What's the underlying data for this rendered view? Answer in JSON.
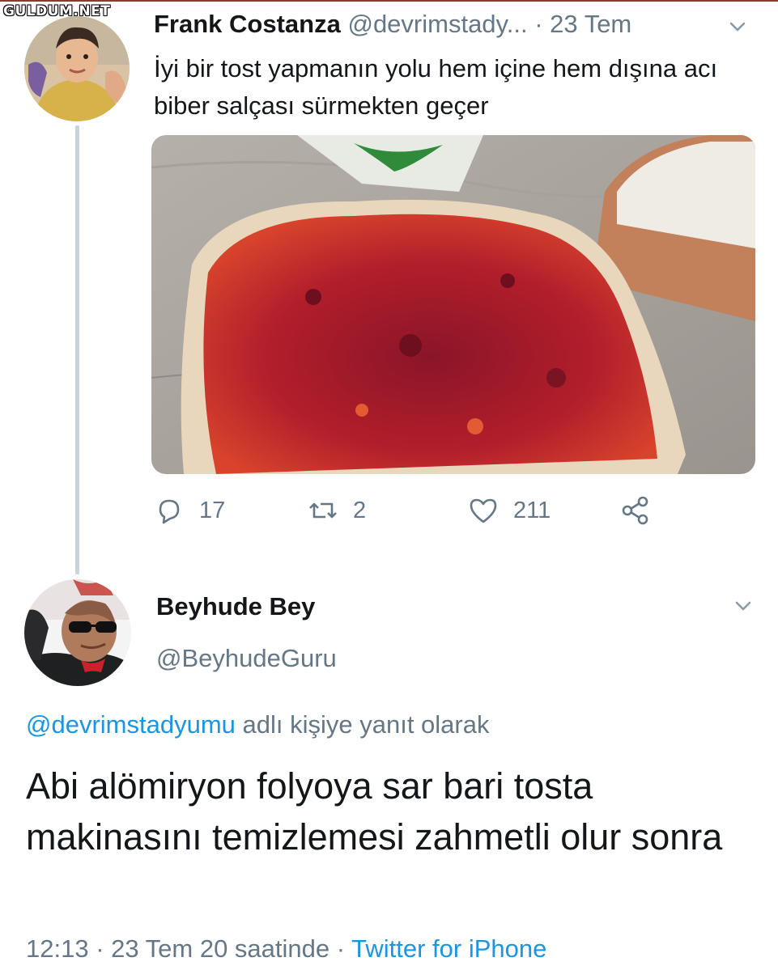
{
  "watermark": "GULDUM.NET",
  "tweet1": {
    "name": "Frank Costanza",
    "handle": "@devrimstady...",
    "time": "· 23 Tem",
    "text": "İyi bir tost yapmanın yolu hem içine hem dışına acı biber salçası sürmekten geçer",
    "avatar": "avatar-photo-child",
    "media": "bread-with-red-pepper-paste-photo",
    "actions": {
      "replies": "17",
      "retweets": "2",
      "likes": "211"
    }
  },
  "tweet2": {
    "name": "Beyhude Bey",
    "handle": "@BeyhudeGuru",
    "reply_mention": "@devrimstadyumu",
    "reply_suffix": " adlı kişiye yanıt olarak",
    "text": "Abi alömiryon folyoya sar bari tosta makinasını temizlemesi zahmetli olur sonra",
    "time": "12:13 · 23 Tem 20 saatinde · ",
    "source": "Twitter for iPhone",
    "avatar": "avatar-photo-sunglasses-man"
  },
  "colors": {
    "accent": "#1b95e0",
    "secondary_text": "#657786",
    "primary_text": "#14171a",
    "thread_line": "#c9d3da"
  }
}
